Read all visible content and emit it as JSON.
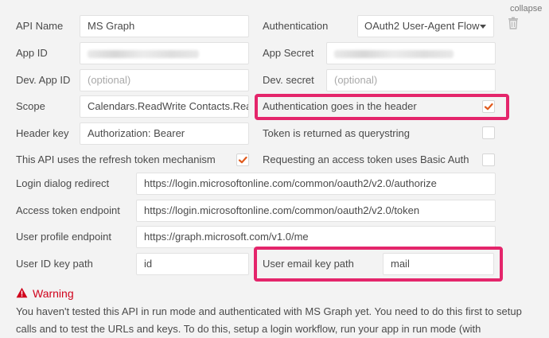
{
  "header": {
    "collapse_label": "collapse"
  },
  "fields": {
    "api_name": {
      "label": "API Name",
      "value": "MS Graph"
    },
    "app_id": {
      "label": "App ID"
    },
    "dev_app_id": {
      "label": "Dev. App ID",
      "placeholder": "(optional)"
    },
    "scope": {
      "label": "Scope",
      "value": "Calendars.ReadWrite Contacts.Rea"
    },
    "header_key": {
      "label": "Header key",
      "value": "Authorization: Bearer"
    },
    "authentication": {
      "label": "Authentication",
      "value": "OAuth2 User-Agent Flow"
    },
    "app_secret": {
      "label": "App Secret"
    },
    "dev_secret": {
      "label": "Dev. secret",
      "placeholder": "(optional)"
    },
    "auth_in_header": {
      "label": "Authentication goes in the header",
      "checked": true
    },
    "token_querystring": {
      "label": "Token is returned as querystring",
      "checked": false
    },
    "refresh_token": {
      "label": "This API uses the refresh token mechanism",
      "checked": true
    },
    "basic_auth": {
      "label": "Requesting an access token uses Basic Auth",
      "checked": false
    },
    "login_redirect": {
      "label": "Login dialog redirect",
      "value": "https://login.microsoftonline.com/common/oauth2/v2.0/authorize"
    },
    "token_endpoint": {
      "label": "Access token endpoint",
      "value": "https://login.microsoftonline.com/common/oauth2/v2.0/token"
    },
    "profile_endpoint": {
      "label": "User profile endpoint",
      "value": "https://graph.microsoft.com/v1.0/me"
    },
    "user_id_path": {
      "label": "User ID key path",
      "value": "id"
    },
    "user_email_path": {
      "label": "User email key path",
      "value": "mail"
    }
  },
  "warning": {
    "title": "Warning",
    "line1": "You haven't tested this API in run mode and authenticated with MS Graph yet. You need to do this first to setup",
    "line2": "calls and to test the URLs and keys. To do this, setup a login workflow, run your app in run mode (with"
  },
  "colors": {
    "highlight": "#e4256b",
    "check": "#e05a1c",
    "warning": "#d0021b"
  }
}
